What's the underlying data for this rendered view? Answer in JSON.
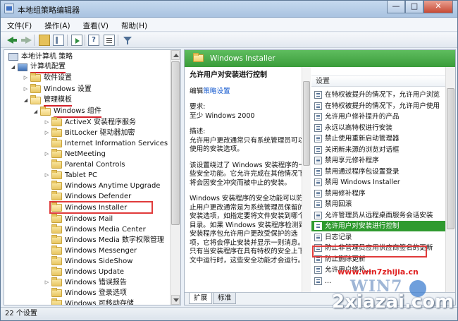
{
  "window": {
    "title": "本地组策略编辑器",
    "minimize": "—",
    "maximize": "□",
    "close": "✕"
  },
  "menu": [
    "文件(F)",
    "操作(A)",
    "查看(V)",
    "帮助(H)"
  ],
  "toolbar_icons": [
    "back-icon",
    "forward-icon",
    "up-folder-icon",
    "show-tree-icon",
    "export-icon",
    "help-icon",
    "properties-icon",
    "filter-icon"
  ],
  "tree": [
    {
      "label": "本地计算机 策略",
      "level": 0,
      "icon": "computer-policy-icon"
    },
    {
      "label": "计算机配置",
      "level": 1,
      "icon": "computer-icon",
      "expanded": true
    },
    {
      "label": "软件设置",
      "level": 2,
      "icon": "folder-icon"
    },
    {
      "label": "Windows 设置",
      "level": 2,
      "icon": "folder-icon"
    },
    {
      "label": "管理模板",
      "level": 2,
      "icon": "folder-icon",
      "expanded": true
    },
    {
      "label": "Windows 组件",
      "level": 3,
      "icon": "folder-icon",
      "expanded": true
    },
    {
      "label": "ActiveX 安装程序服务",
      "level": 4
    },
    {
      "label": "BitLocker 驱动器加密",
      "level": 4
    },
    {
      "label": "Internet Information Services",
      "level": 4
    },
    {
      "label": "NetMeeting",
      "level": 4
    },
    {
      "label": "Parental Controls",
      "level": 4
    },
    {
      "label": "Tablet PC",
      "level": 4
    },
    {
      "label": "Windows Anytime Upgrade",
      "level": 4
    },
    {
      "label": "Windows Defender",
      "level": 4
    },
    {
      "label": "Windows Installer",
      "level": 4,
      "selected": true
    },
    {
      "label": "Windows Mail",
      "level": 4
    },
    {
      "label": "Windows Media Center",
      "level": 4
    },
    {
      "label": "Windows Media 数字权限管理",
      "level": 4
    },
    {
      "label": "Windows Messenger",
      "level": 4
    },
    {
      "label": "Windows SideShow",
      "level": 4
    },
    {
      "label": "Windows Update",
      "level": 4
    },
    {
      "label": "Windows 错误报告",
      "level": 4
    },
    {
      "label": "Windows 登录选项",
      "level": 4
    },
    {
      "label": "Windows 可移动存储",
      "level": 4
    }
  ],
  "content": {
    "header_title": "Windows Installer",
    "policy_title": "允许用户对安装进行控制",
    "edit_prefix": "编辑",
    "edit_link": "策略设置",
    "requirements_label": "要求:",
    "requirements_value": "至少 Windows 2000",
    "description_label": "描述:",
    "desc_p1": "允许用户更改通常只有系统管理员可以使用的安装选项。",
    "desc_p2": "该设置绕过了 Windows 安装程序的一些安全功能。它允许完成在其他情况下将会因安全冲突而被中止的安装。",
    "desc_p3": "Windows 安装程序的安全功能可以防止用户更改通常是为系统管理员保留的安装选项，如指定要将文件安装到哪个目录。如果 Windows 安装程序检测到安装程序包允许用户更改受保护的选项，它将会停止安装并显示一则消息。只有当安装程序在具有特权的安全上下文中运行时，这些安全功能才会运行。"
  },
  "settings": {
    "header": "设置",
    "items": [
      "在特权被提升的情况下，允许用户浏览",
      "在特权被提升的情况下，允许用户使用",
      "允许用户修补提升的产品",
      "永远以高特权进行安装",
      "禁止使用重新启动管理器",
      "关闭新来源的浏览对话框",
      "禁用享元修补程序",
      "禁用通过程序包设置登录",
      "禁用 Windows Installer",
      "禁用修补程序",
      "禁用回滚",
      "允许管理员从远程桌面服务会话安装",
      "允许用户对安装进行控制",
      "日志记录",
      "防止非管理员应用供应商签名的更新",
      "防止删除更新",
      "允许用户修补...",
      "..."
    ],
    "selected_index": 12
  },
  "tabs": [
    "扩展",
    "标准"
  ],
  "status": "22 个设置",
  "watermark": {
    "url": "www.win7zhijia.cn",
    "logo1": "WIN7",
    "logo2": "2xiazai.com"
  }
}
